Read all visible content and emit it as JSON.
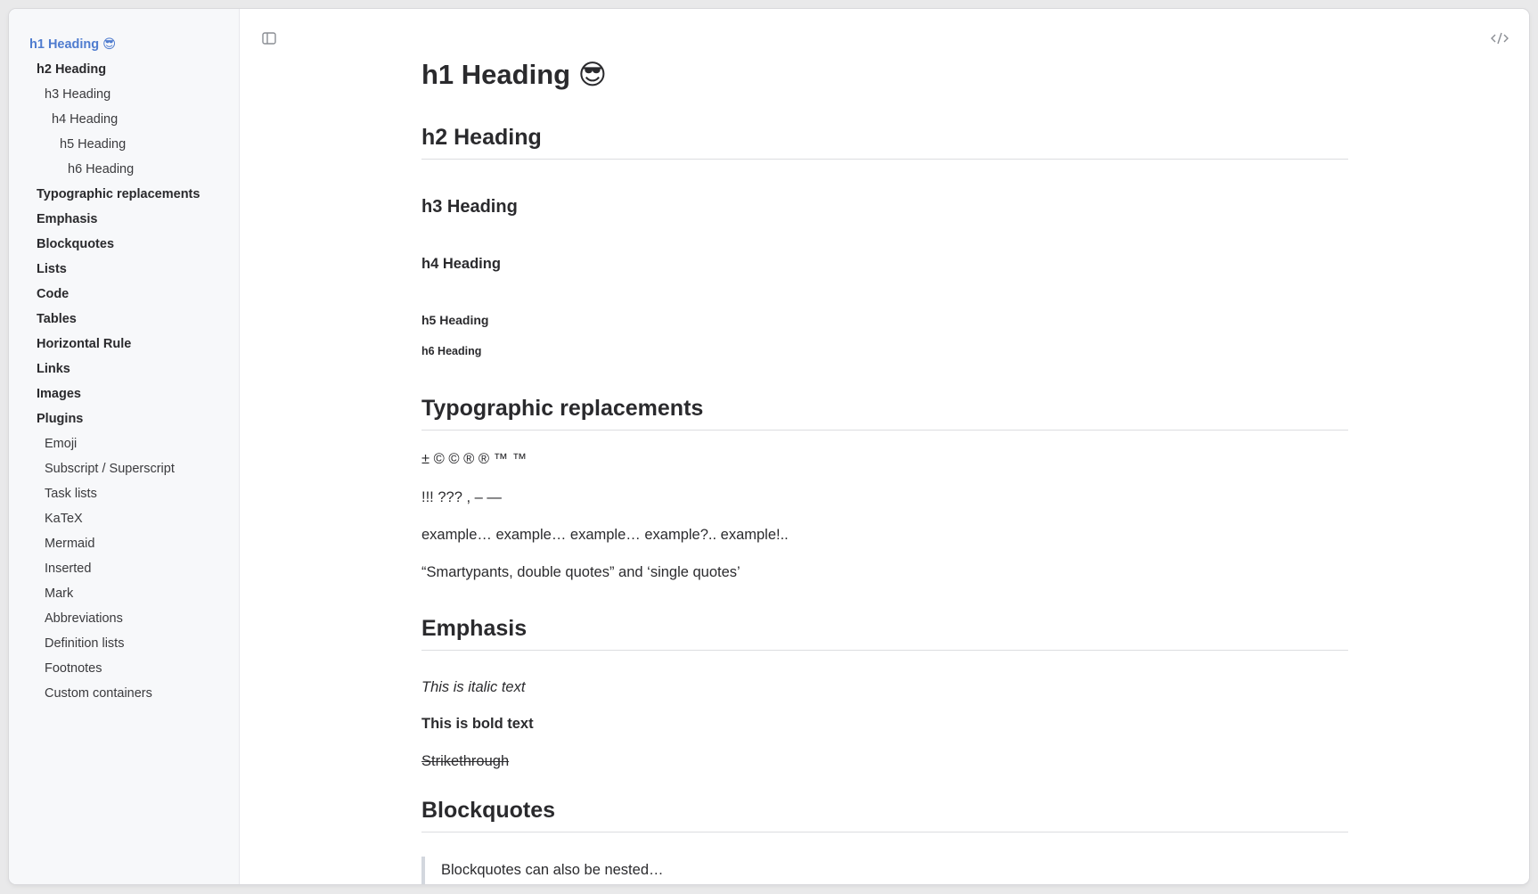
{
  "toc": [
    {
      "label": "h1 Heading 😎",
      "level": 1
    },
    {
      "label": "h2 Heading",
      "level": 2
    },
    {
      "label": "h3 Heading",
      "level": 3
    },
    {
      "label": "h4 Heading",
      "level": 4
    },
    {
      "label": "h5 Heading",
      "level": 5
    },
    {
      "label": "h6 Heading",
      "level": 6
    },
    {
      "label": "Typographic replacements",
      "level": 2
    },
    {
      "label": "Emphasis",
      "level": 2
    },
    {
      "label": "Blockquotes",
      "level": 2
    },
    {
      "label": "Lists",
      "level": 2
    },
    {
      "label": "Code",
      "level": 2
    },
    {
      "label": "Tables",
      "level": 2
    },
    {
      "label": "Horizontal Rule",
      "level": 2
    },
    {
      "label": "Links",
      "level": 2
    },
    {
      "label": "Images",
      "level": 2
    },
    {
      "label": "Plugins",
      "level": 2
    },
    {
      "label": "Emoji",
      "level": 3
    },
    {
      "label": "Subscript / Superscript",
      "level": 3
    },
    {
      "label": "Task lists",
      "level": 3
    },
    {
      "label": "KaTeX",
      "level": 3
    },
    {
      "label": "Mermaid",
      "level": 3
    },
    {
      "label": "Inserted",
      "level": 3
    },
    {
      "label": "Mark",
      "level": 3
    },
    {
      "label": "Abbreviations",
      "level": 3
    },
    {
      "label": "Definition lists",
      "level": 3
    },
    {
      "label": "Footnotes",
      "level": 3
    },
    {
      "label": "Custom containers",
      "level": 3
    }
  ],
  "document": {
    "h1": "h1 Heading 😎",
    "h2": "h2 Heading",
    "h3": "h3 Heading",
    "h4": "h4 Heading",
    "h5": "h5 Heading",
    "h6": "h6 Heading",
    "typographic": {
      "heading": "Typographic replacements",
      "line1": "± © © ® ® ™ ™",
      "line2": "!!! ??? , – —",
      "line3": "example… example… example… example?.. example!..",
      "line4": "“Smartypants, double quotes” and ‘single quotes’"
    },
    "emphasis": {
      "heading": "Emphasis",
      "italic": "This is italic text",
      "bold": "This is bold text",
      "strike": "Strikethrough"
    },
    "blockquotes": {
      "heading": "Blockquotes",
      "quote": "Blockquotes can also be nested…"
    }
  },
  "icons": {
    "sidebar_toggle": "sidebar-toggle-icon",
    "code_toggle": "code-view-icon"
  },
  "colors": {
    "active_toc": "#4f7ccf",
    "sidebar_bg": "#f7f8fa"
  }
}
